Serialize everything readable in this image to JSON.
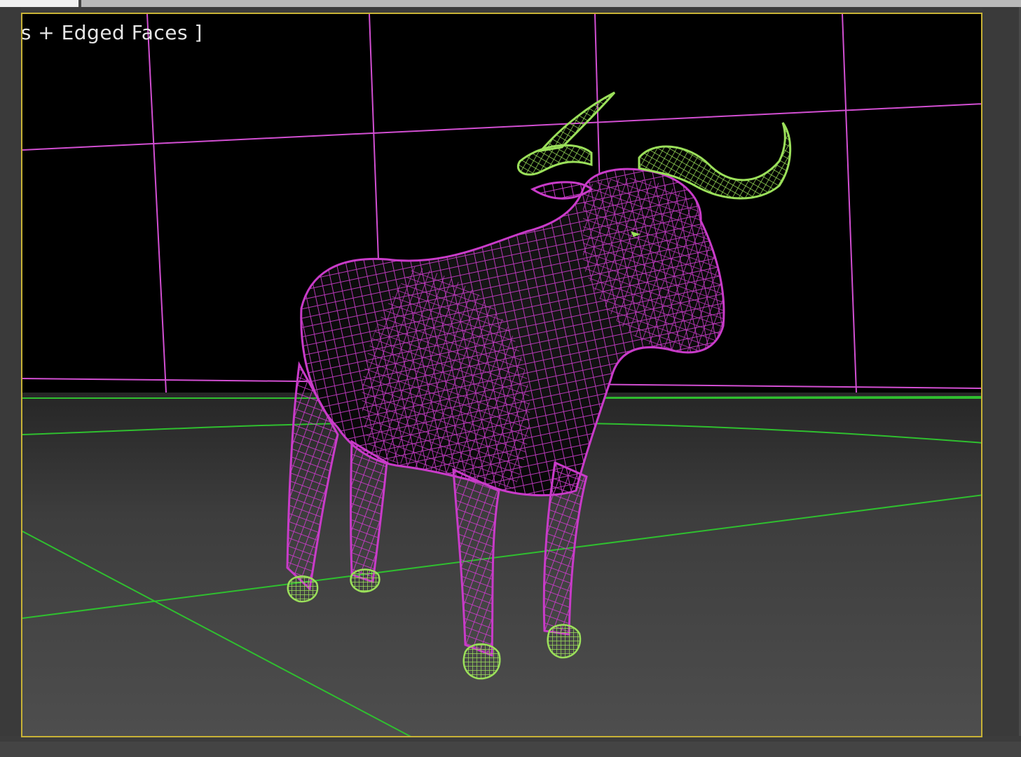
{
  "viewport": {
    "label": "hts + Edged Faces ]",
    "name": "perspective-viewport",
    "colors": {
      "border": "#c8b236",
      "background_top": "#000000",
      "floor_top": "#2a2a2a",
      "floor_bottom": "#4c4c4c",
      "backdrop_wire": "#d24fd2",
      "floor_grid": "#2fbf2f",
      "bull_wire": "#c93bc9",
      "horns_hooves_wire": "#9be05a"
    },
    "objects": [
      {
        "name": "backdrop-plane",
        "kind": "wireframe"
      },
      {
        "name": "ground-grid",
        "kind": "grid"
      },
      {
        "name": "bull-body",
        "kind": "wireframe mesh"
      },
      {
        "name": "bull-horns",
        "kind": "wireframe mesh (selected)"
      },
      {
        "name": "bull-hooves",
        "kind": "wireframe mesh (selected)"
      }
    ]
  }
}
